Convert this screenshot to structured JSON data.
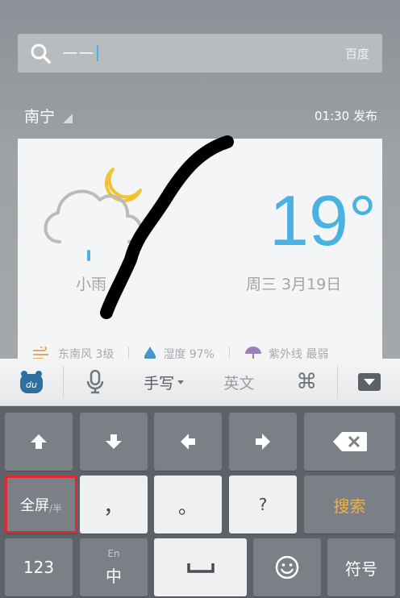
{
  "search": {
    "text": "一一",
    "engine": "百度"
  },
  "header": {
    "city": "南宁",
    "publish_time": "01:30 发布"
  },
  "weather": {
    "condition": "小雨",
    "temperature": "19°",
    "date": "周三 3月19日",
    "wind": "东南风 3级",
    "humidity": "湿度 97%",
    "uv": "紫外线 最弱",
    "colors": {
      "temperature": "#4ab2e3",
      "sun": "#f2c230",
      "cloud": "#b9bcbf",
      "rain": "#4ab2e3"
    }
  },
  "toolbar": {
    "handwriting": "手写",
    "english": "英文"
  },
  "keyboard": {
    "fullscreen_main": "全屏",
    "fullscreen_sub": "/半",
    "comma": "，",
    "period": "。",
    "question": "?",
    "search": "搜索",
    "numbers": "123",
    "lang_sup": "En",
    "lang_main": "中",
    "symbols": "符号",
    "search_color": "#f2b23a",
    "highlight_color": "#e0262e"
  }
}
